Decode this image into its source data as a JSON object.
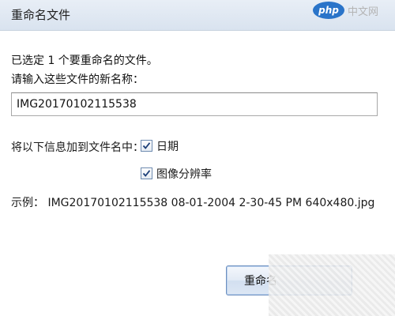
{
  "window": {
    "title": "重命名文件",
    "close_glyph": "×"
  },
  "watermark": {
    "logo": "php",
    "text": "中文网"
  },
  "message": {
    "selected_count": "已选定 1 个要重命名的文件。",
    "prompt": "请输入这些文件的新名称："
  },
  "name_input": {
    "value": "IMG20170102115538"
  },
  "attributes": {
    "label": "将以下信息加到文件名中：",
    "options": [
      {
        "label": "日期",
        "checked": true
      },
      {
        "label": "图像分辨率",
        "checked": true
      }
    ]
  },
  "example": {
    "text": "示例： IMG20170102115538 08-01-2004 2-30-45 PM 640x480.jpg"
  },
  "buttons": {
    "rename_label": "重命名"
  }
}
